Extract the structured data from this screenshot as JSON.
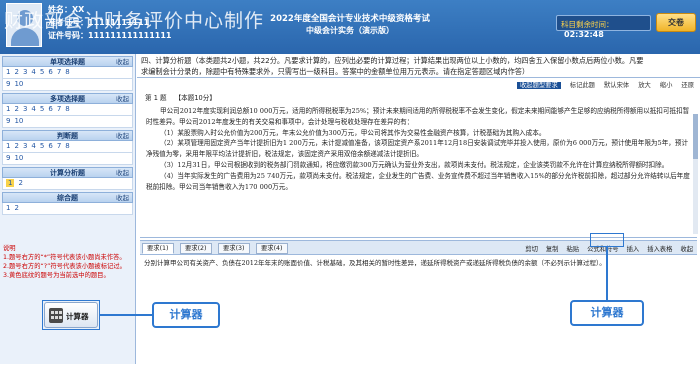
{
  "header": {
    "name_label": "姓名：XX",
    "exam_no_label": "准考证号：11111111111",
    "id_label": "证件号码：111111111111111",
    "watermark": "财政部会计财务评价中心制作",
    "title": "2022年度全国会计专业技术中级资格考试",
    "subtitle": "中级会计实务（演示版）",
    "timer_label": "科目剩余时间：",
    "timer_value": "02:32:48",
    "submit_label": "交卷"
  },
  "sidebar": {
    "sections": [
      {
        "title": "单项选择题",
        "collapse": "收起",
        "numbers": [
          "1",
          "2",
          "3",
          "4",
          "5",
          "6",
          "7",
          "8",
          "9",
          "10"
        ]
      },
      {
        "title": "多项选择题",
        "collapse": "收起",
        "numbers": [
          "1",
          "2",
          "3",
          "4",
          "5",
          "6",
          "7",
          "8",
          "9",
          "10"
        ]
      },
      {
        "title": "判断题",
        "collapse": "收起",
        "numbers": [
          "1",
          "2",
          "3",
          "4",
          "5",
          "6",
          "7",
          "8",
          "9",
          "10"
        ]
      },
      {
        "title": "计算分析题",
        "collapse": "收起",
        "numbers": [
          "1",
          "2"
        ]
      },
      {
        "title": "综合题",
        "collapse": "收起",
        "numbers": [
          "1",
          "2"
        ]
      }
    ],
    "notes": {
      "heading": "说明",
      "line1": "1.题号右方的“*”符号代表该小题尚未作答。",
      "line2": "2.题号右方的“?”符号代表该小题被标记过。",
      "line3": "3.黄色底纹的题号为当前选中的题目。"
    },
    "calculator_label": "计算器"
  },
  "main": {
    "question_title": "四、计算分析题（本类题共2小题，共22分。凡要求计算的，应列出必要的计算过程；计算结果出现两位以上小数的，均四舍五入保留小数点后两位小数。凡要",
    "question_title2": "求编制会计分录的，除题中有特殊要求外，只需写出一级科目。答案中的金额单位用万元表示。请在指定答题区域内作答）",
    "tools": [
      "收起题型要求",
      "标记此题",
      "默认宋体",
      "放大",
      "缩小",
      "还原"
    ],
    "pager": {
      "label": "第 1 题",
      "score": "【本题10分】"
    },
    "paragraphs": [
      "甲公司2012年度实现利润总额10 000万元，适用的所得税税率为25%；预计未来期间适用的所得税税率不会发生变化，假定未来期间能够产生足够的应纳税所得额用以抵扣可抵扣暂时性差异。甲公司2012年度发生的有关交易和事项中，会计处理与税收处理存在差异的有：",
      "（1）某股票购入时公允价值为200万元，年末公允价值为300万元，甲公司将其作为交易性金融资产核算，计税基础为其购入成本。",
      "（2）某项管理用固定资产当年计提折旧为1 200万元，未计提减值准备，该项固定资产系2011年12月18日安装调试完毕并投入使用，原价为6 000万元，预计使用年限为5年，预计净残值为零，采用年限平均法计提折旧，税法规定，该固定资产采用双倍余额递减法计提折旧。",
      "（3）12月31日，甲公司根据收到的税务部门罚款通知，将应缴罚款300万元确认为营业外支出，款项尚未支付。税法规定，企业该类罚款不允许在计算应纳税所得额时扣除。",
      "（4）当年实际发生的广告费用为25 740万元，款项尚未支付。税法规定，企业发生的广告费、业务宣传费不超过当年销售收入15%的部分允许税前扣除，超过部分允许结转以后年度税前扣除。甲公司当年销售收入为170 000万元。"
    ],
    "answer_tabs": [
      "要求(1)",
      "要求(2)",
      "要求(3)",
      "要求(4)"
    ],
    "answer_tools": [
      "剪切",
      "复制",
      "粘贴",
      "公式和符号",
      "插入",
      "插入表格",
      "收起"
    ],
    "answer_text": "分别计算甲公司有关资产、负债在2012年年末的账面价值、计税基础，及其相关的暂时性差异，递延所得税资产或递延所得税负债的余额（不必列示计算过程）。"
  },
  "callouts": {
    "left": "计算器",
    "right": "计算器"
  }
}
